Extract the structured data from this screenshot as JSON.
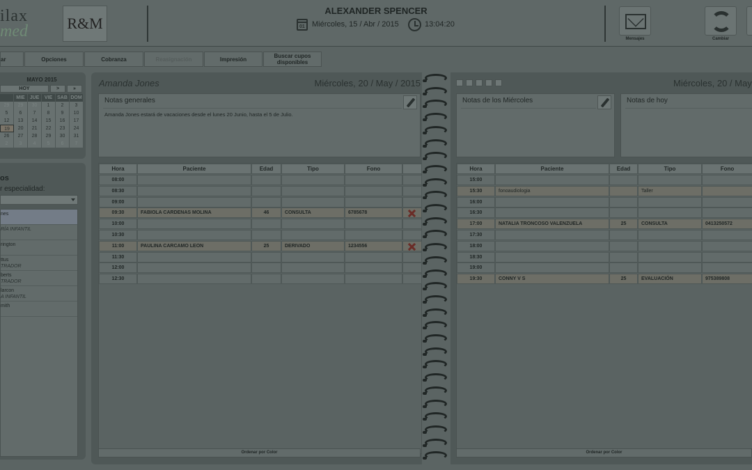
{
  "header": {
    "logo_line1": "ilax",
    "logo_line2": "med",
    "partner_logo": "R&M",
    "user_name": "ALEXANDER SPENCER",
    "calendar_icon_day": "01",
    "date": "Miércoles, 15 / Abr / 2015",
    "time": "13:04:20",
    "buttons": [
      {
        "label": "Mensajes",
        "icon": "envelope-icon"
      },
      {
        "label": "Cambiar",
        "icon": "refresh-icon"
      }
    ]
  },
  "toolbar": {
    "items": [
      {
        "label": "ar",
        "disabled": false
      },
      {
        "label": "Opciones",
        "disabled": false
      },
      {
        "label": "Cobranza",
        "disabled": false
      },
      {
        "label": "Reasignación",
        "disabled": true
      },
      {
        "label": "Impresión",
        "disabled": false
      },
      {
        "label": "Buscar cupos disponibles",
        "disabled": false
      }
    ]
  },
  "mini_calendar": {
    "title": "MAYO 2015",
    "today_label": "HOY",
    "next_label": ">",
    "fast_next_label": "»",
    "weekdays": [
      "",
      "MIE",
      "JUE",
      "VIE",
      "SAB",
      "DOM"
    ],
    "weeks": [
      [
        "29",
        "29",
        "30",
        "1",
        "2",
        "3"
      ],
      [
        "5",
        "6",
        "7",
        "8",
        "9",
        "10"
      ],
      [
        "12",
        "13",
        "14",
        "15",
        "16",
        "17"
      ],
      [
        "19",
        "20",
        "21",
        "22",
        "23",
        "24"
      ],
      [
        "26",
        "27",
        "28",
        "29",
        "30",
        "31"
      ],
      [
        "2",
        "3",
        "4",
        "5",
        "6",
        "7"
      ]
    ]
  },
  "professionals_panel": {
    "title": "os",
    "filter_label": "r especialidad:",
    "items": [
      {
        "name": "nes",
        "specialty": "",
        "selected": true
      },
      {
        "name": "",
        "specialty": "RÍA INFANTIL",
        "selected": false
      },
      {
        "name": "rington",
        "specialty": "",
        "selected": false
      },
      {
        "name": "ttus",
        "specialty": "TRADOR",
        "selected": false
      },
      {
        "name": "berts",
        "specialty": "TRADOR",
        "selected": false
      },
      {
        "name": "larcon",
        "specialty": "A INFANTIL",
        "selected": false
      },
      {
        "name": "mith",
        "specialty": "",
        "selected": false
      }
    ]
  },
  "left_page": {
    "professional": "Amanda Jones",
    "date": "Miércoles, 20 / May / 2015",
    "notes_title": "Notas generales",
    "notes_text": "Amanda Jones estará de vacaciones desde el lunes 20 Junio, hasta el 5 de Julio.",
    "columns": [
      "Hora",
      "Paciente",
      "Edad",
      "Tipo",
      "Fono",
      ""
    ],
    "rows": [
      {
        "hora": "08:00",
        "paciente": "",
        "edad": "",
        "tipo": "",
        "fono": "",
        "delete": false
      },
      {
        "hora": "08:30",
        "paciente": "",
        "edad": "",
        "tipo": "",
        "fono": "",
        "delete": false
      },
      {
        "hora": "09:00",
        "paciente": "",
        "edad": "",
        "tipo": "",
        "fono": "",
        "delete": false
      },
      {
        "hora": "09:30",
        "paciente": "FABIOLA CARDENAS MOLINA",
        "edad": "46",
        "tipo": "CONSULTA",
        "fono": "6785678",
        "delete": true
      },
      {
        "hora": "10:00",
        "paciente": "",
        "edad": "",
        "tipo": "",
        "fono": "",
        "delete": false
      },
      {
        "hora": "10:30",
        "paciente": "",
        "edad": "",
        "tipo": "",
        "fono": "",
        "delete": false
      },
      {
        "hora": "11:00",
        "paciente": "PAULINA CARCAMO LEON",
        "edad": "25",
        "tipo": "DERIVADO",
        "fono": "1234556",
        "delete": true
      },
      {
        "hora": "11:30",
        "paciente": "",
        "edad": "",
        "tipo": "",
        "fono": "",
        "delete": false
      },
      {
        "hora": "12:00",
        "paciente": "",
        "edad": "",
        "tipo": "",
        "fono": "",
        "delete": false
      },
      {
        "hora": "12:30",
        "paciente": "",
        "edad": "",
        "tipo": "",
        "fono": "",
        "delete": false
      }
    ],
    "order_label": "Ordenar por Color"
  },
  "right_page": {
    "date": "Miércoles, 20 / May",
    "notes_weekday_title": "Notas de los Miércoles",
    "notes_today_title": "Notas de hoy",
    "columns": [
      "Hora",
      "Paciente",
      "Edad",
      "Tipo",
      "Fono"
    ],
    "rows": [
      {
        "hora": "15:00",
        "paciente": "",
        "edad": "",
        "tipo": "",
        "fono": ""
      },
      {
        "hora": "15:30",
        "paciente": "fonoaudiologia",
        "edad": "",
        "tipo": "Taller",
        "fono": ""
      },
      {
        "hora": "16:00",
        "paciente": "",
        "edad": "",
        "tipo": "",
        "fono": ""
      },
      {
        "hora": "16:30",
        "paciente": "",
        "edad": "",
        "tipo": "",
        "fono": ""
      },
      {
        "hora": "17:00",
        "paciente": "NATALIA TRONCOSO VALENZUELA",
        "edad": "25",
        "tipo": "CONSULTA",
        "fono": "0413250572"
      },
      {
        "hora": "17:30",
        "paciente": "",
        "edad": "",
        "tipo": "",
        "fono": ""
      },
      {
        "hora": "18:00",
        "paciente": "",
        "edad": "",
        "tipo": "",
        "fono": ""
      },
      {
        "hora": "18:30",
        "paciente": "",
        "edad": "",
        "tipo": "",
        "fono": ""
      },
      {
        "hora": "19:00",
        "paciente": "",
        "edad": "",
        "tipo": "",
        "fono": ""
      },
      {
        "hora": "19:30",
        "paciente": "CONNY V S",
        "edad": "25",
        "tipo": "EVALUACIÓN",
        "fono": "975389808"
      }
    ],
    "order_label": "Ordenar por Color"
  }
}
